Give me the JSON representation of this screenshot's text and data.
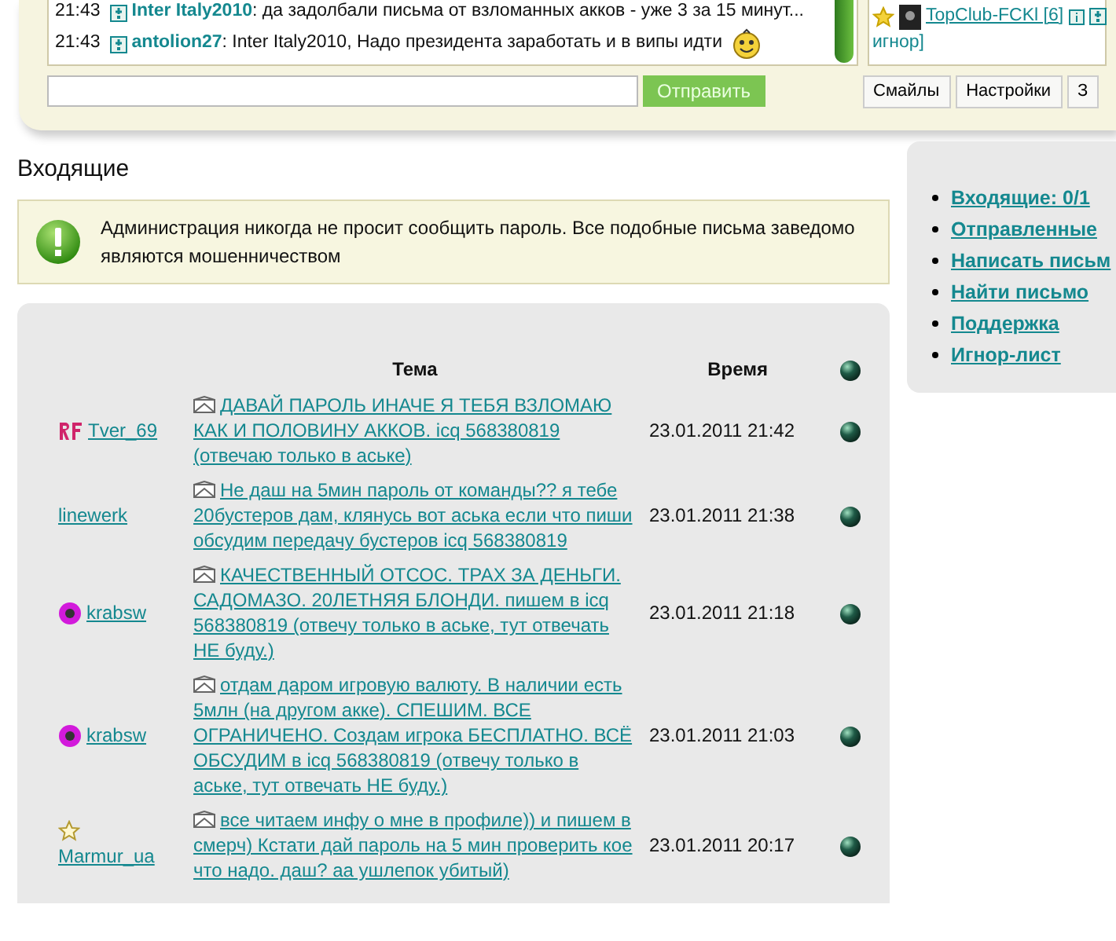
{
  "chat": {
    "messages": [
      {
        "time": "21:43",
        "user": "Inter Italy2010",
        "text": ": да задолбали письма от взломанных акков - уже 3 за 15 минут...",
        "smiley": false
      },
      {
        "time": "21:43",
        "user": "antolion27",
        "text": ": Inter Italy2010, Надо президента заработать и в випы идти",
        "smiley": true
      }
    ],
    "users": [
      {
        "name": "TopClub-FCKl",
        "count": "[6]",
        "suffix": "игнор]"
      }
    ],
    "send_button": "Отправить",
    "buttons": [
      "Смайлы",
      "Настройки",
      "З"
    ]
  },
  "inbox": {
    "title": "Входящие",
    "alert": "Администрация никогда не просит сообщить пароль. Все подобные письма заведомо являются мошенничеством",
    "columns": [
      "Тема",
      "Время"
    ],
    "rows": [
      {
        "sender": "Tver_69",
        "kind": "rf",
        "subject": "ДАВАЙ ПАРОЛЬ ИНАЧЕ Я ТЕБЯ ВЗЛОМАЮ КАК И ПОЛОВИНУ АККОВ. icq 568380819 (отвечаю только в аське)",
        "time": "23.01.2011 21:42"
      },
      {
        "sender": "linewerk",
        "kind": "plain",
        "subject": "Не даш на 5мин пароль от команды?? я тебе 20бустеров дам, клянусь вот аська если что пиши обсудим передачу бустеров icq 568380819",
        "time": "23.01.2011 21:38"
      },
      {
        "sender": "krabsw",
        "kind": "ball",
        "subject": "КАЧЕСТВЕННЫЙ ОТСОС. ТРАХ ЗА ДЕНЬГИ. САДОМАЗО. 20ЛЕТНЯЯ БЛОНДИ. пишем в icq 568380819 (отвечу только в аське, тут отвечать НЕ буду.)",
        "time": "23.01.2011 21:18"
      },
      {
        "sender": "krabsw",
        "kind": "ball",
        "subject": "отдам даром игровую валюту. В наличии есть 5млн (на другом акке). СПЕШИМ. ВСЕ ОГРАНИЧЕНО. Создам игрока БЕСПЛАТНО. ВСЁ ОБСУДИМ в icq 568380819 (отвечу только в аське, тут отвечать НЕ буду.)",
        "time": "23.01.2011 21:03"
      },
      {
        "sender": "Marmur_ua",
        "kind": "star",
        "subject": "все читаем инфу о мне в профиле)) и пишем в смерч) Кстати дай пароль на 5 мин проверить кое что надо. даш? аа ушлепок убитый)",
        "time": "23.01.2011 20:17"
      }
    ]
  },
  "sidebar": {
    "items": [
      "Входящие: 0/1",
      "Отправленные",
      "Написать письм",
      "Найти письмо",
      "Поддержка",
      "Игнор-лист"
    ]
  }
}
